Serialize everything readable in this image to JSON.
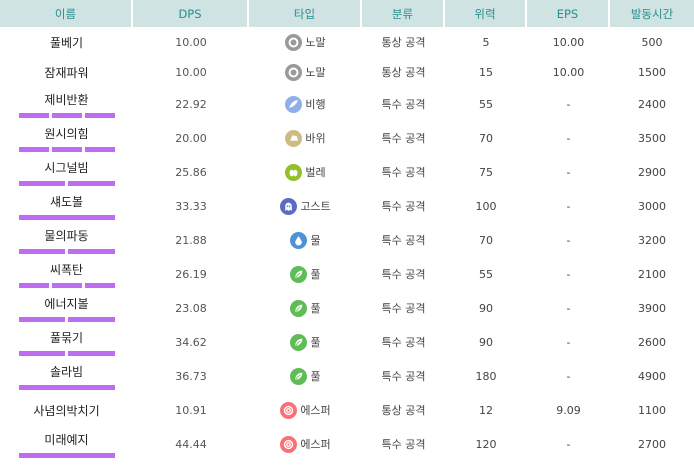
{
  "header": {
    "name": "이름",
    "dps": "DPS",
    "type": "타입",
    "category": "분류",
    "power": "위력",
    "eps": "EPS",
    "duration": "발동시간"
  },
  "colors": {
    "header_bg": "#cfe3e3",
    "header_text": "#2a8e8e",
    "energy_bar": "#bd6ef0"
  },
  "rows": [
    {
      "name": "풀베기",
      "dps": "10.00",
      "type": "노말",
      "icon": "normal-type-icon",
      "color": "#9a9a9a",
      "category": "통상 공격",
      "power": "5",
      "eps": "10.00",
      "duration": "500",
      "bars": 0
    },
    {
      "name": "잠재파워",
      "dps": "10.00",
      "type": "노말",
      "icon": "normal-type-icon",
      "color": "#9a9a9a",
      "category": "통상 공격",
      "power": "15",
      "eps": "10.00",
      "duration": "1500",
      "bars": 0
    },
    {
      "name": "제비반환",
      "dps": "22.92",
      "type": "비행",
      "icon": "flying-type-icon",
      "color": "#8fb0e6",
      "category": "특수 공격",
      "power": "55",
      "eps": "-",
      "duration": "2400",
      "bars": 3
    },
    {
      "name": "원시의힘",
      "dps": "20.00",
      "type": "바위",
      "icon": "rock-type-icon",
      "color": "#cdbb84",
      "category": "특수 공격",
      "power": "70",
      "eps": "-",
      "duration": "3500",
      "bars": 3
    },
    {
      "name": "시그널빔",
      "dps": "25.86",
      "type": "벌레",
      "icon": "bug-type-icon",
      "color": "#92c12a",
      "category": "특수 공격",
      "power": "75",
      "eps": "-",
      "duration": "2900",
      "bars": 2
    },
    {
      "name": "섀도볼",
      "dps": "33.33",
      "type": "고스트",
      "icon": "ghost-type-icon",
      "color": "#5a6cc4",
      "category": "특수 공격",
      "power": "100",
      "eps": "-",
      "duration": "3000",
      "bars": 1
    },
    {
      "name": "물의파동",
      "dps": "21.88",
      "type": "물",
      "icon": "water-type-icon",
      "color": "#4f92d6",
      "category": "특수 공격",
      "power": "70",
      "eps": "-",
      "duration": "3200",
      "bars": 2
    },
    {
      "name": "씨폭탄",
      "dps": "26.19",
      "type": "풀",
      "icon": "grass-type-icon",
      "color": "#5fbd58",
      "category": "특수 공격",
      "power": "55",
      "eps": "-",
      "duration": "2100",
      "bars": 3
    },
    {
      "name": "에너지볼",
      "dps": "23.08",
      "type": "풀",
      "icon": "grass-type-icon",
      "color": "#5fbd58",
      "category": "특수 공격",
      "power": "90",
      "eps": "-",
      "duration": "3900",
      "bars": 2
    },
    {
      "name": "풀묶기",
      "dps": "34.62",
      "type": "풀",
      "icon": "grass-type-icon",
      "color": "#5fbd58",
      "category": "특수 공격",
      "power": "90",
      "eps": "-",
      "duration": "2600",
      "bars": 2
    },
    {
      "name": "솔라빔",
      "dps": "36.73",
      "type": "풀",
      "icon": "grass-type-icon",
      "color": "#5fbd58",
      "category": "특수 공격",
      "power": "180",
      "eps": "-",
      "duration": "4900",
      "bars": 1
    },
    {
      "name": "사념의박치기",
      "dps": "10.91",
      "type": "에스퍼",
      "icon": "psychic-type-icon",
      "color": "#f97176",
      "category": "통상 공격",
      "power": "12",
      "eps": "9.09",
      "duration": "1100",
      "bars": 0
    },
    {
      "name": "미래예지",
      "dps": "44.44",
      "type": "에스퍼",
      "icon": "psychic-type-icon",
      "color": "#f97176",
      "category": "특수 공격",
      "power": "120",
      "eps": "-",
      "duration": "2700",
      "bars": 1
    }
  ]
}
